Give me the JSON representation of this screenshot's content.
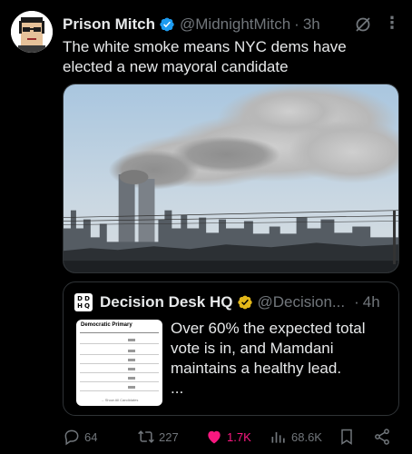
{
  "author": {
    "name": "Prison Mitch",
    "handle": "@MidnightMitch",
    "separator": "·",
    "time": "3h"
  },
  "tweet": {
    "text": "The white smoke means NYC dems have elected a new mayoral candidate"
  },
  "quote": {
    "logo_letters": [
      "D",
      "D",
      "H",
      "Q"
    ],
    "name": "Decision Desk HQ",
    "handle": "@Decision...",
    "separator": "·",
    "time": "4h",
    "text": "Over 60% the expected total vote is in, and Mamdani maintains a healthy lead.",
    "ellipsis": "...",
    "thumb_title": "Democratic Primary",
    "thumb_footer": "→ Show All Candidates"
  },
  "actions": {
    "reply_count": "64",
    "repost_count": "227",
    "like_count": "1.7K",
    "views_count": "68.6K"
  },
  "icons": {
    "verified": "verified-badge-icon",
    "grok": "grok-icon",
    "more": "more-icon",
    "reply": "reply-icon",
    "repost": "repost-icon",
    "like": "heart-icon",
    "views": "views-icon",
    "bookmark": "bookmark-icon",
    "share": "share-icon"
  },
  "colors": {
    "background": "#000000",
    "text": "#e7e9ea",
    "muted": "#71767b",
    "verified_blue": "#1d9bf0",
    "gold": "#e2b719",
    "like_pink": "#f91880"
  }
}
